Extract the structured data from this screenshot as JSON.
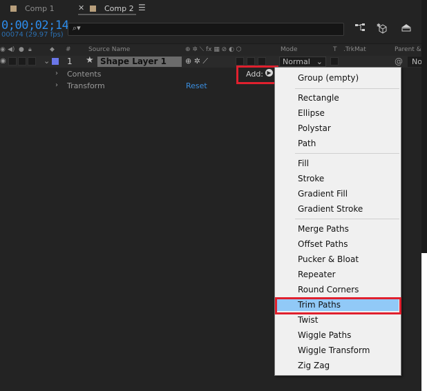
{
  "tabs": [
    {
      "label": "Comp 1"
    },
    {
      "label": "Comp 2"
    }
  ],
  "timeline": {
    "timecode": "0;00;02;14",
    "frames_fps": "00074 (29.97 fps)"
  },
  "columns": {
    "number": "#",
    "source_name": "Source Name",
    "mode": "Mode",
    "t": "T",
    "trkmat": ".TrkMat",
    "parent": "Parent &"
  },
  "layer": {
    "index": "1",
    "name": "Shape Layer 1",
    "mode": "Normal",
    "parent_value": "No",
    "color": "#6a76e8"
  },
  "properties": [
    {
      "label": "Contents"
    },
    {
      "label": "Transform",
      "action": "Reset"
    }
  ],
  "add_button": {
    "label": "Add:"
  },
  "menu": {
    "items": [
      "Group (empty)",
      "Rectangle",
      "Ellipse",
      "Polystar",
      "Path",
      "Fill",
      "Stroke",
      "Gradient Fill",
      "Gradient Stroke",
      "Merge Paths",
      "Offset Paths",
      "Pucker & Bloat",
      "Repeater",
      "Round Corners",
      "Trim Paths",
      "Twist",
      "Wiggle Paths",
      "Wiggle Transform",
      "Zig Zag"
    ],
    "highlighted": "Trim Paths"
  },
  "colors": {
    "accent_blue": "#2d8ceb",
    "highlight": "#91c9f7",
    "annotation_red": "#e0202e"
  }
}
